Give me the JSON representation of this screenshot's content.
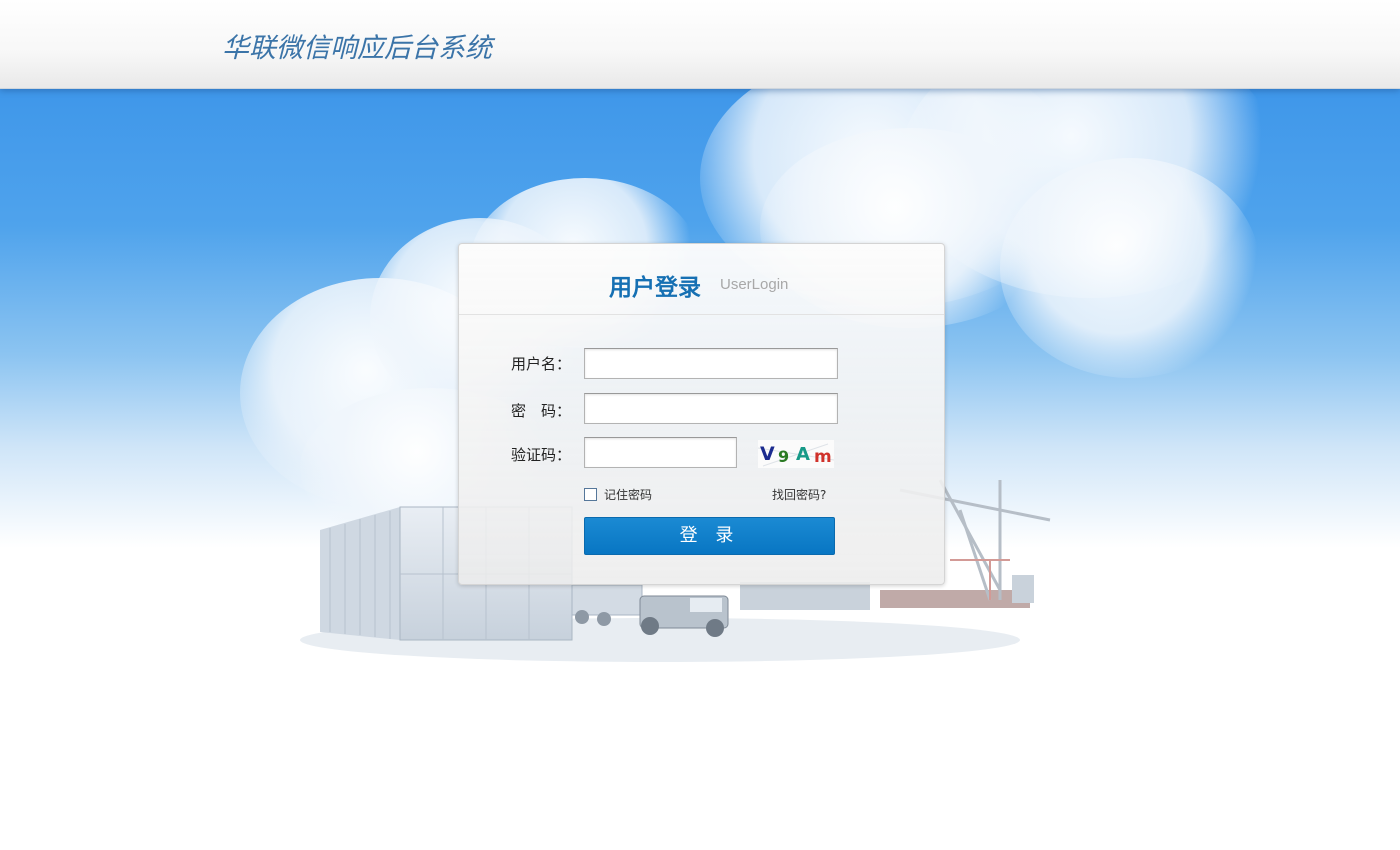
{
  "header": {
    "brand": "华联微信响应后台系统"
  },
  "login": {
    "title": "用户登录",
    "subtitle": "UserLogin",
    "username_label": "用户名：",
    "username_value": "",
    "password_label": "密　码：",
    "password_value": "",
    "captcha_label": "验证码：",
    "captcha_value": "",
    "captcha_text": "V9Am",
    "remember_label": "记住密码",
    "remember_checked": false,
    "forgot_label": "找回密码?",
    "submit_label": "登 录"
  },
  "colors": {
    "brand": "#3b74a8",
    "title": "#1670b3",
    "button": "#0a7ac7",
    "sky_top": "#3f97ea"
  }
}
